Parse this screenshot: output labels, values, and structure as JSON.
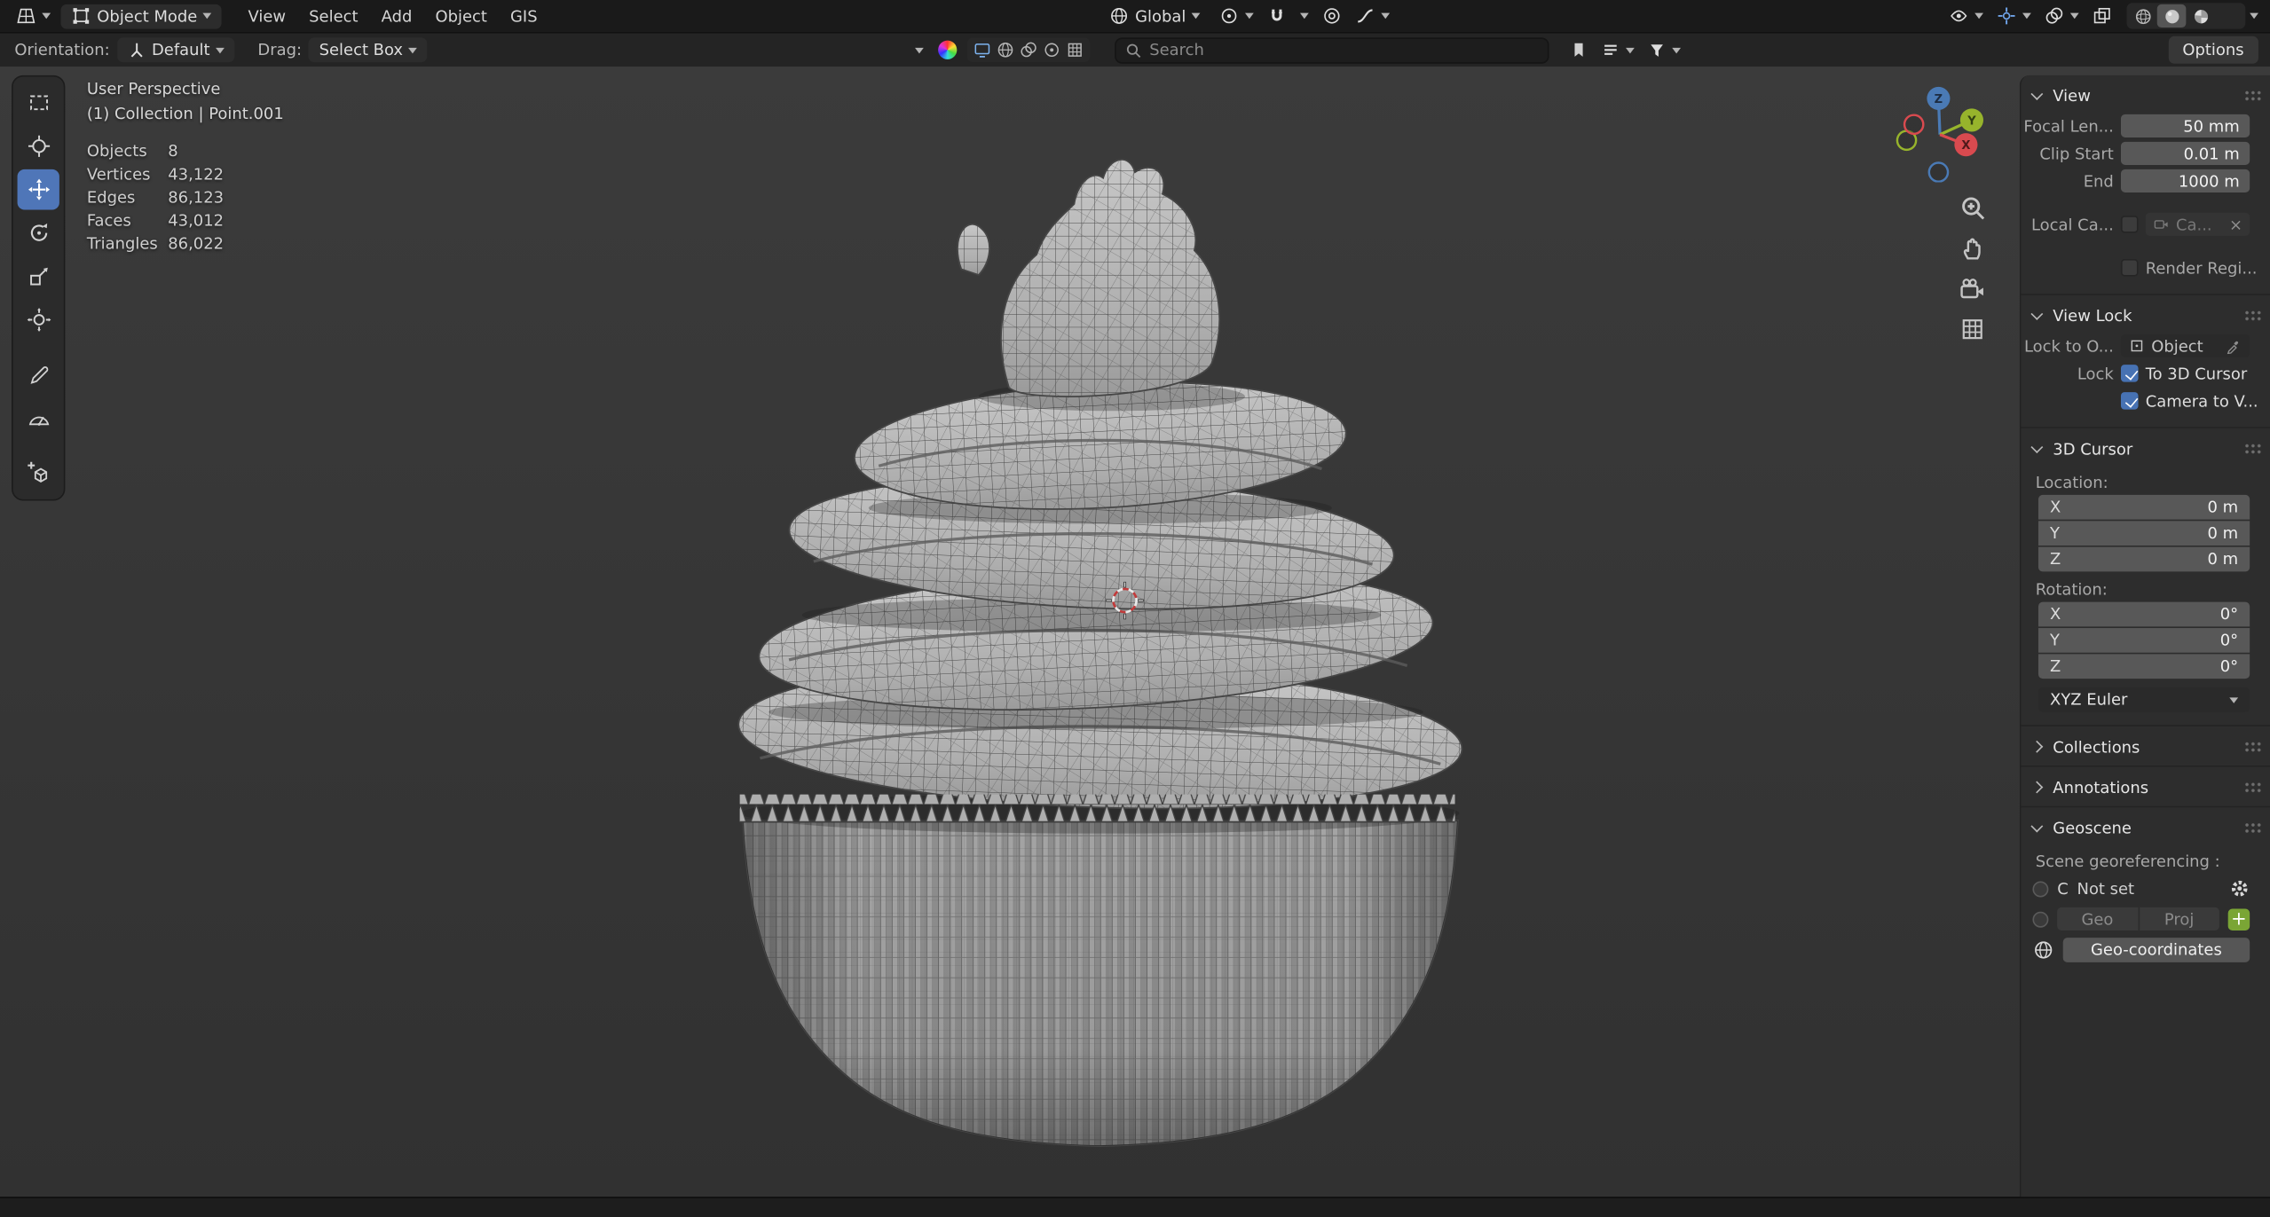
{
  "colors": {
    "accent": "#4772b3",
    "axis_x": "#d94a4f",
    "axis_y": "#97b42c",
    "axis_z": "#4a7ab5",
    "add_button": "#7aa535",
    "tool_active": "#4f76b8"
  },
  "icons": {
    "clear": "×",
    "add": "+"
  },
  "icon_names": [
    "editor-type-icon",
    "object-mode-icon",
    "globe-icon",
    "pivot-point-icon",
    "magnet-icon",
    "proportional-editing-icon",
    "falloff-curve-icon",
    "object-visibility-icon",
    "gizmos-icon",
    "overlays-icon",
    "xray-icon",
    "wireframe-shading-icon",
    "solid-shading-icon",
    "material-shading-icon",
    "rendered-shading-icon",
    "color-wheel-icon",
    "search-icon",
    "bookmark-icon",
    "list-icon",
    "funnel-icon",
    "select-box-icon",
    "cursor-icon",
    "move-icon",
    "rotate-icon",
    "scale-icon",
    "transform-icon",
    "annotate-icon",
    "measure-icon",
    "add-cube-icon",
    "zoom-icon",
    "hand-icon",
    "camera-icon",
    "grid-icon",
    "gear-icon",
    "eyedropper-icon",
    "camera-small-icon",
    "object-icon"
  ],
  "header": {
    "mode_label": "Object Mode",
    "menus": [
      "View",
      "Select",
      "Add",
      "Object",
      "GIS"
    ],
    "orientation_value": "Global"
  },
  "tool_settings": {
    "orientation_label": "Orientation:",
    "orientation_value": "Default",
    "drag_label": "Drag:",
    "drag_value": "Select Box",
    "search_placeholder": "Search",
    "options_label": "Options"
  },
  "viewport": {
    "view_label": "User Perspective",
    "context_label": "(1) Collection | Point.001",
    "stats": [
      {
        "label": "Objects",
        "value": "8"
      },
      {
        "label": "Vertices",
        "value": "43,122"
      },
      {
        "label": "Edges",
        "value": "86,123"
      },
      {
        "label": "Faces",
        "value": "43,012"
      },
      {
        "label": "Triangles",
        "value": "86,022"
      }
    ],
    "axes": {
      "x": "X",
      "y": "Y",
      "z": "Z"
    }
  },
  "sidebar": {
    "view": {
      "title": "View",
      "focal_label": "Focal Len...",
      "focal_value": "50 mm",
      "clip_start_label": "Clip Start",
      "clip_start_value": "0.01 m",
      "clip_end_label": "End",
      "clip_end_value": "1000 m",
      "local_camera_label": "Local Ca...",
      "local_camera_value": "Ca...",
      "render_region_label": "Render Regi..."
    },
    "view_lock": {
      "title": "View Lock",
      "lock_object_label": "Lock to O...",
      "lock_object_value": "Object",
      "lock_label": "Lock",
      "to_3d_cursor_label": "To 3D Cursor",
      "camera_to_view_label": "Camera to V..."
    },
    "cursor": {
      "title": "3D Cursor",
      "location_label": "Location:",
      "rotation_label": "Rotation:",
      "location": [
        {
          "axis": "X",
          "value": "0 m"
        },
        {
          "axis": "Y",
          "value": "0 m"
        },
        {
          "axis": "Z",
          "value": "0 m"
        }
      ],
      "rotation": [
        {
          "axis": "X",
          "value": "0°"
        },
        {
          "axis": "Y",
          "value": "0°"
        },
        {
          "axis": "Z",
          "value": "0°"
        }
      ],
      "euler_value": "XYZ Euler"
    },
    "collections_title": "Collections",
    "annotations_title": "Annotations",
    "geoscene": {
      "title": "Geoscene",
      "georef_label": "Scene georeferencing :",
      "crs_letter": "C",
      "crs_status": "Not set",
      "geo_label": "Geo",
      "proj_label": "Proj",
      "geocoords_label": "Geo-coordinates"
    }
  }
}
